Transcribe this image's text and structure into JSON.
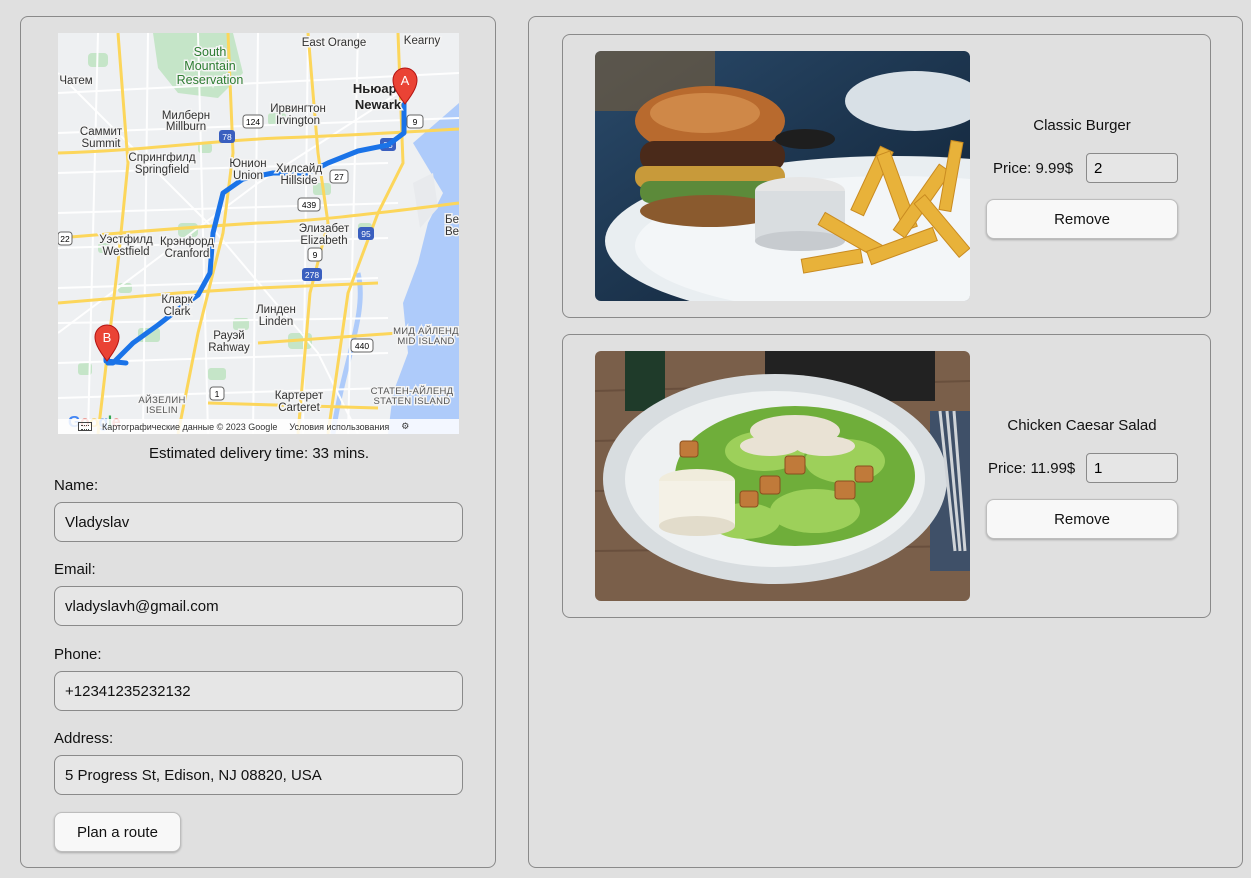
{
  "map": {
    "labels": {
      "south_mountain": "South",
      "south_mountain2": "Mountain",
      "south_mountain3": "Reservation",
      "east_orange": "East Orange",
      "kearny": "Kearny",
      "newark_ru": "Ньюарк",
      "newark": "Newark",
      "chatham": "Чатем",
      "milburn_ru": "Милберн",
      "milburn": "Millburn",
      "irvington_ru": "Ирвингтон",
      "irvington": "Irvington",
      "summit_ru": "Саммит",
      "summit": "Summit",
      "springfield_ru": "Спрингфилд",
      "springfield": "Springfield",
      "union_ru": "Юнион",
      "union": "Union",
      "hillside_ru": "Хилсайд",
      "hillside": "Hillside",
      "westfield_ru": "Уэстфилд",
      "westfield": "Westfield",
      "cranford_ru": "Крэнфорд",
      "cranford": "Cranford",
      "elizabeth_ru": "Элизабет",
      "elizabeth": "Elizabeth",
      "clark_ru": "Кларк",
      "clark": "Clark",
      "linden_ru": "Линден",
      "linden": "Linden",
      "rahway_ru": "Рауэй",
      "rahway": "Rahway",
      "mid_island_ru": "МИД АЙЛЕНД",
      "mid_island": "MID ISLAND",
      "iselin_ru": "АЙЗЕЛИН",
      "iselin": "ISELIN",
      "carteret_ru": "Картерет",
      "carteret": "Carteret",
      "staten_ru": "СТАТЕН-АЙЛЕНД",
      "staten": "STATEN ISLAND",
      "be": "Бе",
      "be2": "Be"
    },
    "highways": [
      "124",
      "78",
      "9",
      "22",
      "27",
      "439",
      "95",
      "278",
      "440",
      "1",
      "9"
    ],
    "marker_a": "A",
    "marker_b": "B",
    "google": [
      "G",
      "o",
      "o",
      "g",
      "l",
      "e"
    ],
    "attribution": "Картографические данные © 2023 Google",
    "terms": "Условия использования"
  },
  "delivery_time": "Estimated delivery time: 33 mins.",
  "form": {
    "name_label": "Name:",
    "name_value": "Vladyslav",
    "email_label": "Email:",
    "email_value": "vladyslavh@gmail.com",
    "phone_label": "Phone:",
    "phone_value": "+12341235232132",
    "address_label": "Address:",
    "address_value": "5 Progress St, Edison, NJ 08820, USA",
    "plan_route_label": "Plan a route"
  },
  "cart": [
    {
      "title": "Classic Burger",
      "price": "Price: 9.99$",
      "quantity": "2",
      "remove_label": "Remove"
    },
    {
      "title": "Chicken Caesar Salad",
      "price": "Price: 11.99$",
      "quantity": "1",
      "remove_label": "Remove"
    }
  ],
  "colors": {
    "route": "#1a73e8",
    "marker": "#ea4335",
    "panel_border": "#8a8a8a",
    "background": "#e0e0e0"
  }
}
